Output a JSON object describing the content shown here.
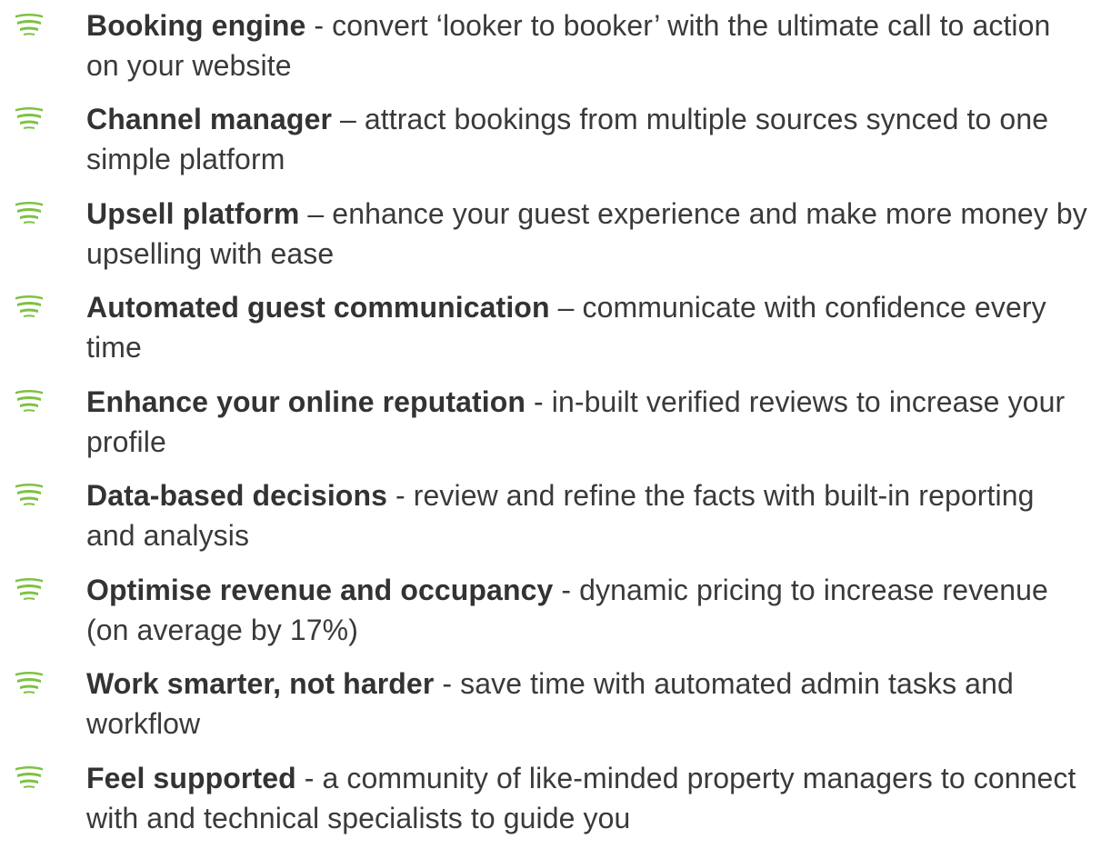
{
  "accent_color": "#7dc242",
  "bullet_icon": "green-stripes-icon",
  "features": [
    {
      "title": "Booking engine",
      "desc": " - convert ‘looker to booker’ with the ultimate call to action on your website"
    },
    {
      "title": "Channel manager",
      "desc": " – attract bookings from multiple sources synced to one simple platform"
    },
    {
      "title": "Upsell platform",
      "desc": " – enhance your guest experience and make more money by upselling with ease"
    },
    {
      "title": "Automated guest communication",
      "desc": " – communicate with confidence every time"
    },
    {
      "title": "Enhance your online reputation",
      "desc": " - in-built verified reviews to increase your profile"
    },
    {
      "title": "Data-based decisions",
      "desc": " - review and refine the facts with built-in reporting and analysis"
    },
    {
      "title": "Optimise revenue and occupancy",
      "desc": " - dynamic pricing to increase revenue (on average by 17%)"
    },
    {
      "title": "Work smarter, not harder",
      "desc": " - save time with automated admin tasks and workflow"
    },
    {
      "title": "Feel supported",
      "desc": " - a community of like-minded property managers to connect with and technical specialists to guide you"
    }
  ]
}
